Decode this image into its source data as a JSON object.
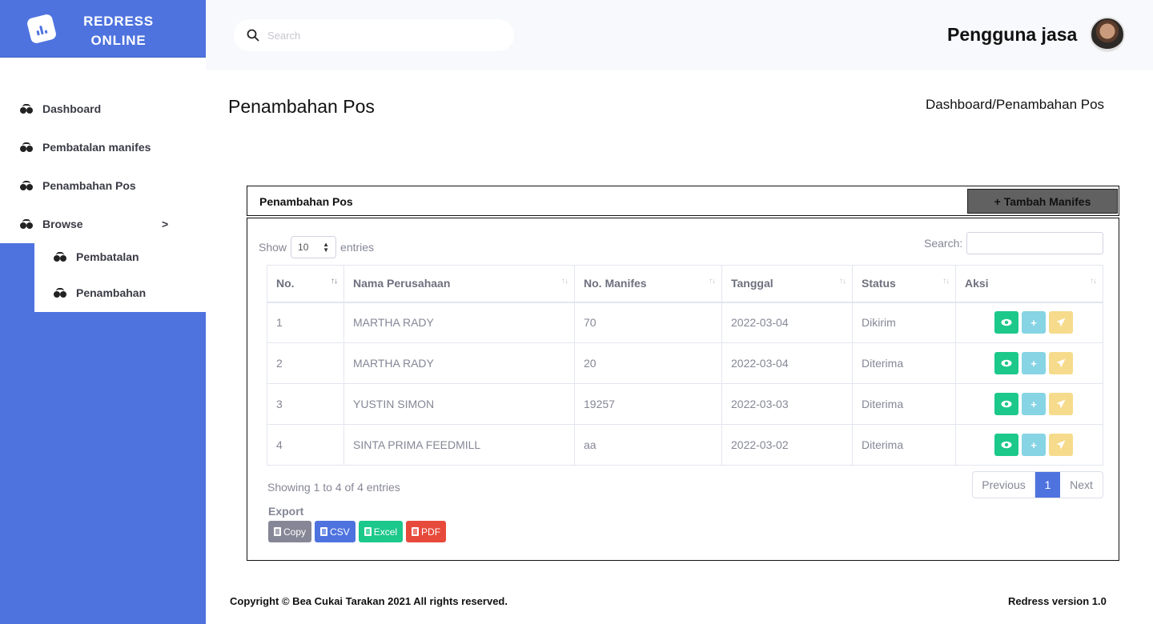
{
  "brand": {
    "line1": "REDRESS",
    "line2": "ONLINE",
    "logo_icon": "chart-bar-icon"
  },
  "sidebar": {
    "items": [
      {
        "label": "Dashboard",
        "icon": "binoculars-icon"
      },
      {
        "label": "Pembatalan manifes",
        "icon": "binoculars-icon"
      },
      {
        "label": "Penambahan Pos",
        "icon": "binoculars-icon"
      },
      {
        "label": "Browse",
        "icon": "binoculars-icon",
        "chevron": ">"
      }
    ],
    "subitems": [
      {
        "label": "Pembatalan",
        "icon": "binoculars-icon"
      },
      {
        "label": "Penambahan",
        "icon": "binoculars-icon"
      }
    ]
  },
  "topbar": {
    "search_placeholder": "Search",
    "user_name": "Pengguna jasa"
  },
  "page": {
    "title": "Penambahan Pos",
    "breadcrumb": "Dashboard/Penambahan Pos"
  },
  "card": {
    "title": "Penambahan Pos",
    "add_button": "+ Tambah  Manifes"
  },
  "table_controls": {
    "show": "Show",
    "page_length": "10",
    "entries": "entries",
    "search_label": "Search:"
  },
  "table": {
    "headers": [
      "No.",
      "Nama Perusahaan",
      "No. Manifes",
      "Tanggal",
      "Status",
      "Aksi"
    ],
    "rows": [
      [
        "1",
        "MARTHA RADY",
        "70",
        "2022-03-04",
        "Dikirim"
      ],
      [
        "2",
        "MARTHA RADY",
        "20",
        "2022-03-04",
        "Diterima"
      ],
      [
        "3",
        "YUSTIN SIMON",
        "19257",
        "2022-03-03",
        "Diterima"
      ],
      [
        "4",
        "SINTA PRIMA FEEDMILL",
        "aa",
        "2022-03-02",
        "Diterima"
      ]
    ],
    "row_actions": [
      "eye-icon",
      "plus-icon",
      "paper-plane-icon"
    ]
  },
  "pagination": {
    "info": "Showing 1 to 4 of 4 entries",
    "previous": "Previous",
    "current": "1",
    "next": "Next"
  },
  "export": {
    "label": "Export",
    "copy": "Copy",
    "csv": "CSV",
    "excel": "Excel",
    "pdf": "PDF"
  },
  "footer": {
    "copyright": "Copyright © Bea Cukai Tarakan 2021 All rights reserved.",
    "version": "Redress version 1.0"
  },
  "colors": {
    "primary": "#4e73df",
    "success": "#1cc88a",
    "info": "#86d4e4",
    "warning": "#f6db8c",
    "danger": "#e74a3b",
    "secondary": "#858796"
  }
}
